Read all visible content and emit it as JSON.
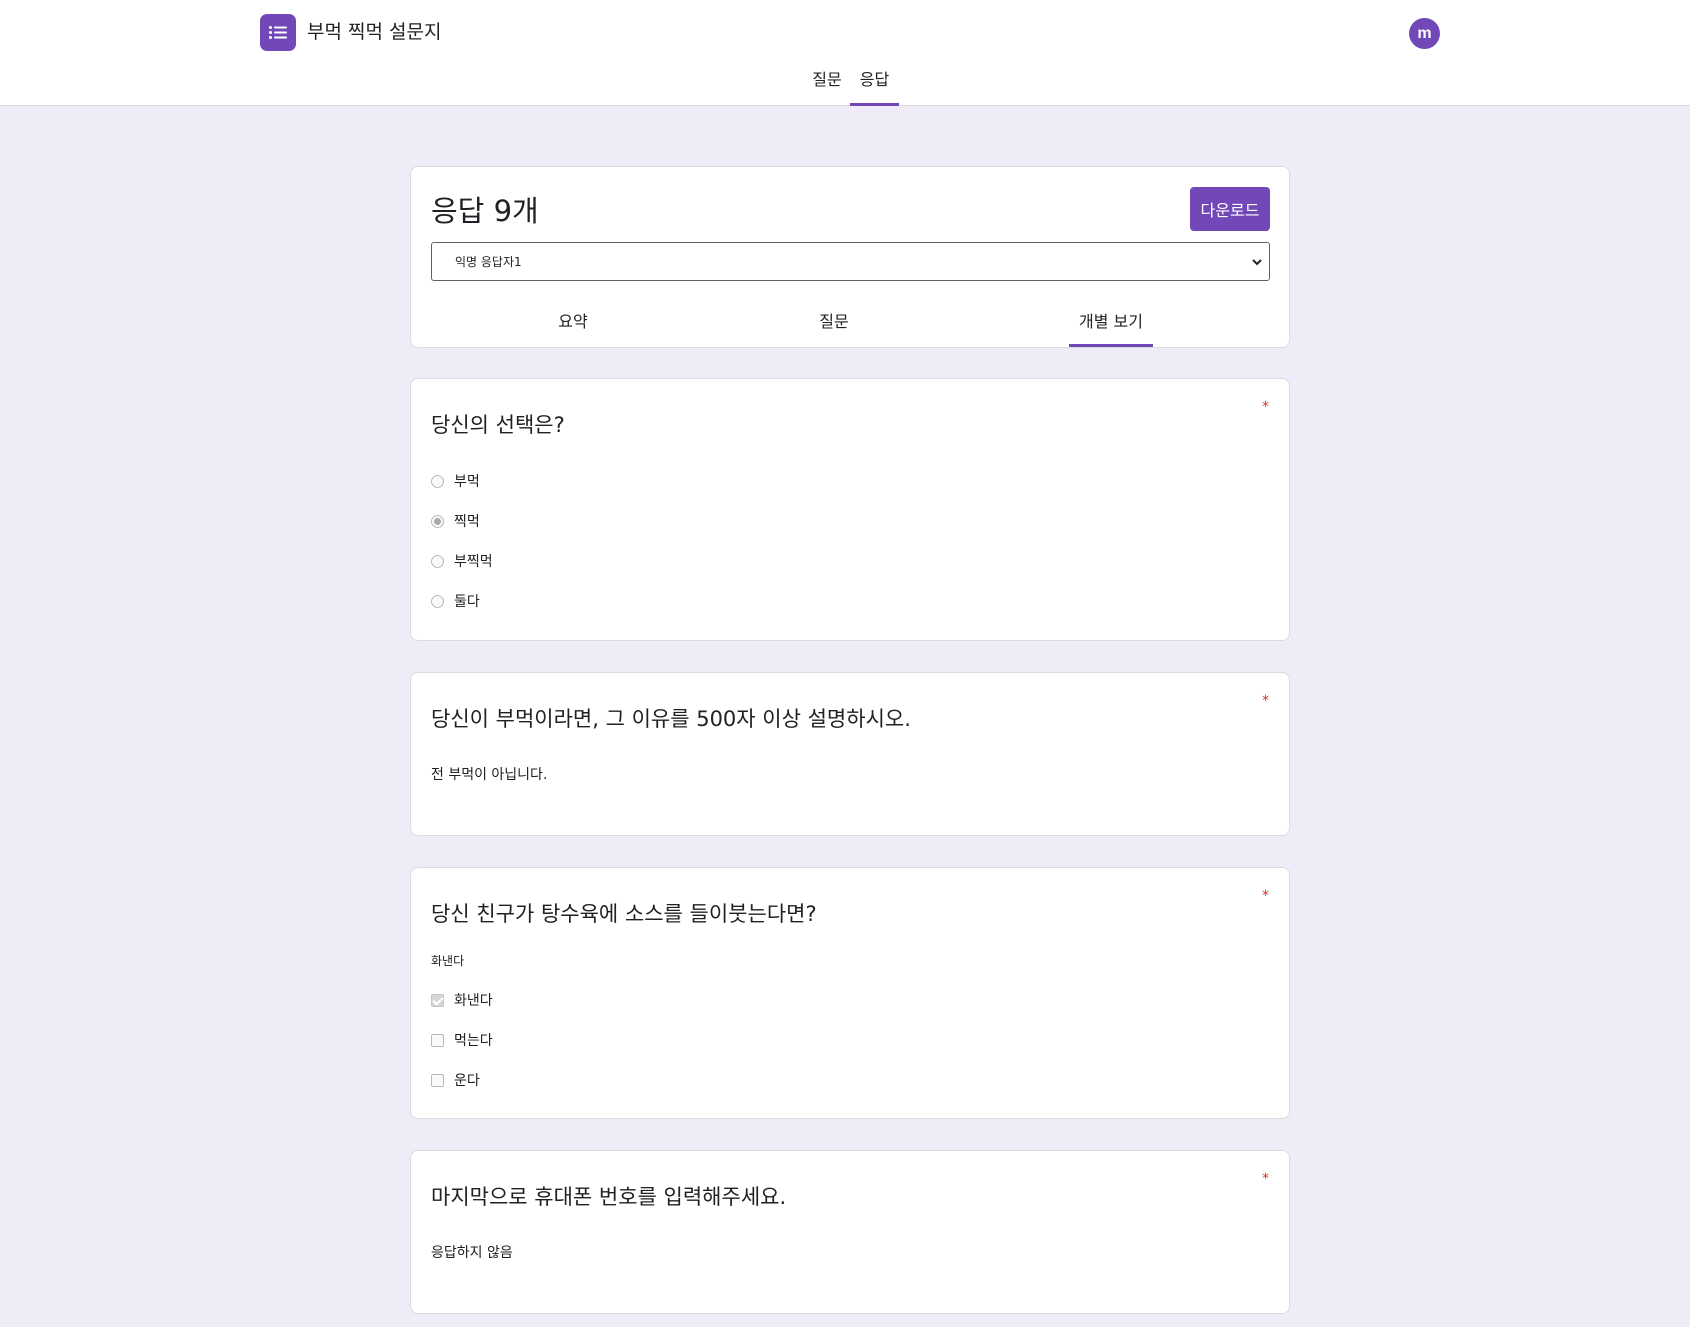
{
  "app": {
    "title": "부먹 찍먹 설문지",
    "avatar_letter": "m",
    "brand_color": "#7248b9"
  },
  "top_tabs": [
    {
      "label": "질문",
      "active": false
    },
    {
      "label": "응답",
      "active": true
    }
  ],
  "responses": {
    "count_label": "응답 9개",
    "download_label": "다운로드",
    "selected_respondent": "익명 응답자1",
    "tabs": [
      {
        "label": "요약",
        "active": false
      },
      {
        "label": "질문",
        "active": false
      },
      {
        "label": "개별 보기",
        "active": true
      }
    ]
  },
  "questions": [
    {
      "title": "당신의 선택은?",
      "required_mark": "*",
      "type": "radio",
      "options": [
        {
          "label": "부먹",
          "checked": false
        },
        {
          "label": "찍먹",
          "checked": true
        },
        {
          "label": "부찍먹",
          "checked": false
        },
        {
          "label": "둘다",
          "checked": false
        }
      ]
    },
    {
      "title": "당신이 부먹이라면, 그 이유를 500자 이상 설명하시오.",
      "required_mark": "*",
      "type": "text",
      "answer": "전 부먹이 아닙니다."
    },
    {
      "title": "당신 친구가 탕수육에 소스를 들이붓는다면?",
      "required_mark": "*",
      "type": "checkbox",
      "answer_summary": "화낸다",
      "options": [
        {
          "label": "화낸다",
          "checked": true
        },
        {
          "label": "먹는다",
          "checked": false
        },
        {
          "label": "운다",
          "checked": false
        }
      ]
    },
    {
      "title": "마지막으로 휴대폰 번호를 입력해주세요.",
      "required_mark": "*",
      "type": "text",
      "answer": "응답하지 않음"
    }
  ]
}
